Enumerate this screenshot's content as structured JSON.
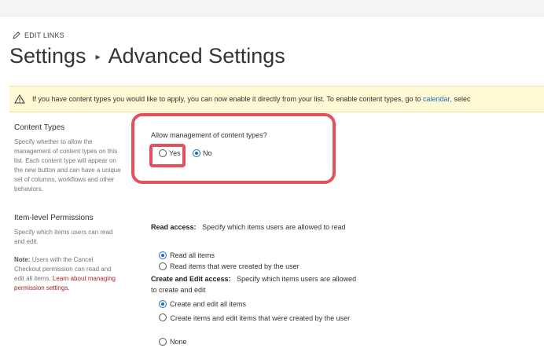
{
  "header": {
    "edit_links": "EDIT LINKS",
    "title_part1": "Settings",
    "title_sep": "▸",
    "title_part2": "Advanced Settings"
  },
  "banner": {
    "text": "If you have content types you would like to apply, you can now enable it directly from your list. To enable content types, go to",
    "link": "calendar",
    "suffix": ", selec"
  },
  "content_types": {
    "title": "Content Types",
    "description": "Specify whether to allow the management of content types on this list. Each content type will appear on the new button and can have a unique set of columns, workflows and other behaviors.",
    "question": "Allow management of content types?",
    "options": [
      {
        "label": "Yes",
        "selected": false
      },
      {
        "label": "No",
        "selected": true
      }
    ]
  },
  "item_permissions": {
    "title": "Item-level Permissions",
    "description": "Specify which items users can read and edit.",
    "note_label": "Note:",
    "note_text": "Users with the Cancel Checkout permission can read and edit all items.",
    "note_link": "Learn about managing permission settings.",
    "read_access": {
      "label": "Read access:",
      "description": "Specify which items users are allowed to read",
      "options": [
        {
          "label": "Read all items",
          "selected": true
        },
        {
          "label": "Read items that were created by the user",
          "selected": false
        }
      ]
    },
    "edit_access": {
      "label": "Create and Edit access:",
      "description": "Specify which items users are allowed to create and edit",
      "options": [
        {
          "label": "Create and edit all items",
          "selected": true
        },
        {
          "label": "Create items and edit items that were created by the user",
          "selected": false
        },
        {
          "label": "None",
          "selected": false
        }
      ]
    }
  },
  "colors": {
    "accent": "#1a6ec2",
    "highlight": "#e4505c",
    "banner_bg": "#fff9d4"
  }
}
